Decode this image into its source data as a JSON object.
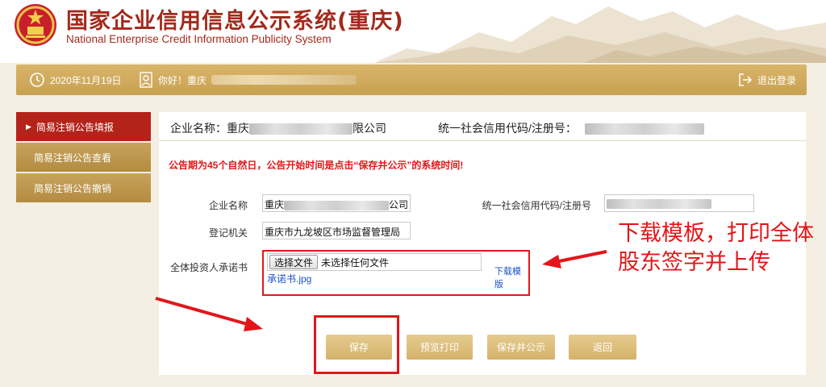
{
  "header": {
    "title_cn": "国家企业信用信息公示系统(重庆)",
    "title_en": "National Enterprise Credit Information Publicity System"
  },
  "topbar": {
    "date": "2020年11月19日",
    "greeting": "你好！重庆",
    "logout_label": "退出登录",
    "icons": [
      "clock-icon",
      "user-icon",
      "logout-icon"
    ]
  },
  "sidebar": {
    "items": [
      {
        "label": "简易注销公告填报",
        "active": true
      },
      {
        "label": "简易注销公告查看",
        "active": false
      },
      {
        "label": "简易注销公告撤销",
        "active": false
      }
    ]
  },
  "main": {
    "company_label": "企业名称：",
    "company_name_prefix": "重庆",
    "company_name_suffix": "限公司",
    "credit_label": "统一社会信用代码/注册号：",
    "notice": "公告期为45个自然日，公告开始时间是点击“保存并公示”的系统时间!",
    "form": {
      "company_name_label": "企业名称",
      "company_name_value_prefix": "重庆",
      "company_name_value_suffix": "公司",
      "credit_code_label": "统一社会信用代码/注册号",
      "registration_authority_label": "登记机关",
      "registration_authority_value": "重庆市九龙坡区市场监督管理局",
      "commitment_label": "全体投资人承诺书",
      "choose_file_button": "选择文件",
      "no_file_text": "未选择任何文件",
      "file_link": "承诺书.jpg",
      "download_template_link": "下载模版"
    },
    "buttons": {
      "save": "保存",
      "preview_print": "预览打印",
      "save_publish": "保存并公示",
      "back": "返回"
    }
  },
  "annotation": {
    "line1": "下载模板，打印全体",
    "line2": "股东签字并上传"
  },
  "colors": {
    "brand_red": "#a22a1c",
    "gold": "#c8a152",
    "alert_red": "#e2161a",
    "link_blue": "#1b52c7"
  }
}
